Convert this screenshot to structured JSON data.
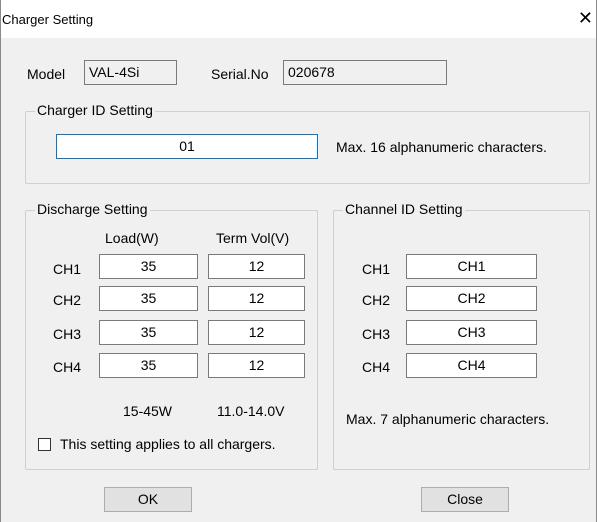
{
  "window": {
    "title": "Charger Setting",
    "close_glyph": "✕"
  },
  "header": {
    "model_label": "Model",
    "model_value": "VAL-4Si",
    "serial_label": "Serial.No",
    "serial_value": "020678"
  },
  "charger_id": {
    "legend": "Charger ID Setting",
    "value": "01",
    "hint": "Max. 16 alphanumeric characters."
  },
  "discharge": {
    "legend": "Discharge Setting",
    "col_load": "Load(W)",
    "col_term": "Term Vol(V)",
    "rows": [
      {
        "ch": "CH1",
        "load": "35",
        "term": "12"
      },
      {
        "ch": "CH2",
        "load": "35",
        "term": "12"
      },
      {
        "ch": "CH3",
        "load": "35",
        "term": "12"
      },
      {
        "ch": "CH4",
        "load": "35",
        "term": "12"
      }
    ],
    "load_range": "15-45W",
    "term_range": "11.0-14.0V",
    "apply_all_label": "This setting applies to all chargers.",
    "apply_all_checked": false
  },
  "channel_id": {
    "legend": "Channel ID Setting",
    "rows": [
      {
        "ch": "CH1",
        "value": "CH1"
      },
      {
        "ch": "CH2",
        "value": "CH2"
      },
      {
        "ch": "CH3",
        "value": "CH3"
      },
      {
        "ch": "CH4",
        "value": "CH4"
      }
    ],
    "hint": "Max. 7 alphanumeric characters."
  },
  "buttons": {
    "ok": "OK",
    "close": "Close"
  }
}
